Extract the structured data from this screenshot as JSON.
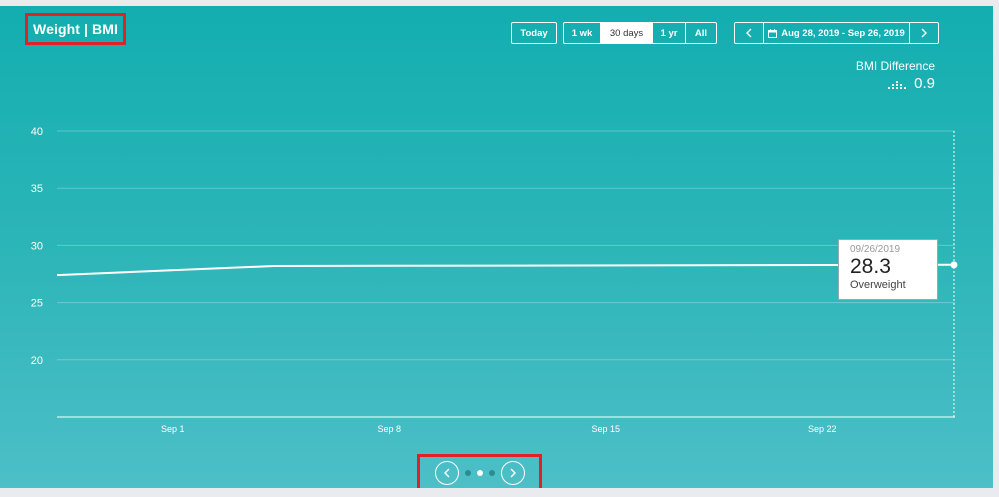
{
  "header": {
    "title": "Weight | BMI"
  },
  "toolbar": {
    "today_label": "Today",
    "ranges": [
      {
        "label": "1 wk",
        "active": false
      },
      {
        "label": "30 days",
        "active": true
      },
      {
        "label": "1 yr",
        "active": false
      },
      {
        "label": "All",
        "active": false
      }
    ],
    "date_range": "Aug 28, 2019 - Sep 26, 2019",
    "icons": {
      "prev": "chevron-left-icon",
      "next": "chevron-right-icon",
      "calendar": "calendar-icon"
    }
  },
  "bmi_difference": {
    "label": "BMI Difference",
    "value": "0.9",
    "icon": "trend-dots-icon"
  },
  "chart_data": {
    "type": "line",
    "xlabel": "",
    "ylabel": "",
    "x_ticks": [
      "Sep 1",
      "Sep 8",
      "Sep 15",
      "Sep 22"
    ],
    "ylim": [
      15,
      40
    ],
    "y_ticks": [
      20,
      25,
      30,
      35,
      40
    ],
    "grid": true,
    "series": [
      {
        "points": [
          {
            "x": "2019-08-28",
            "y": 27.4
          },
          {
            "x": "2019-09-04",
            "y": 28.2
          },
          {
            "x": "2019-09-26",
            "y": 28.3
          }
        ]
      }
    ]
  },
  "tooltip": {
    "date": "09/26/2019",
    "value": "28.3",
    "category": "Overweight"
  },
  "pager": {
    "pages": 3,
    "active_index": 1,
    "icons": {
      "prev": "chevron-left-icon",
      "next": "chevron-right-icon"
    }
  },
  "colors": {
    "accent": "#e02126",
    "panel_top": "#13aeb0",
    "panel_bottom": "#4dbfc7"
  }
}
